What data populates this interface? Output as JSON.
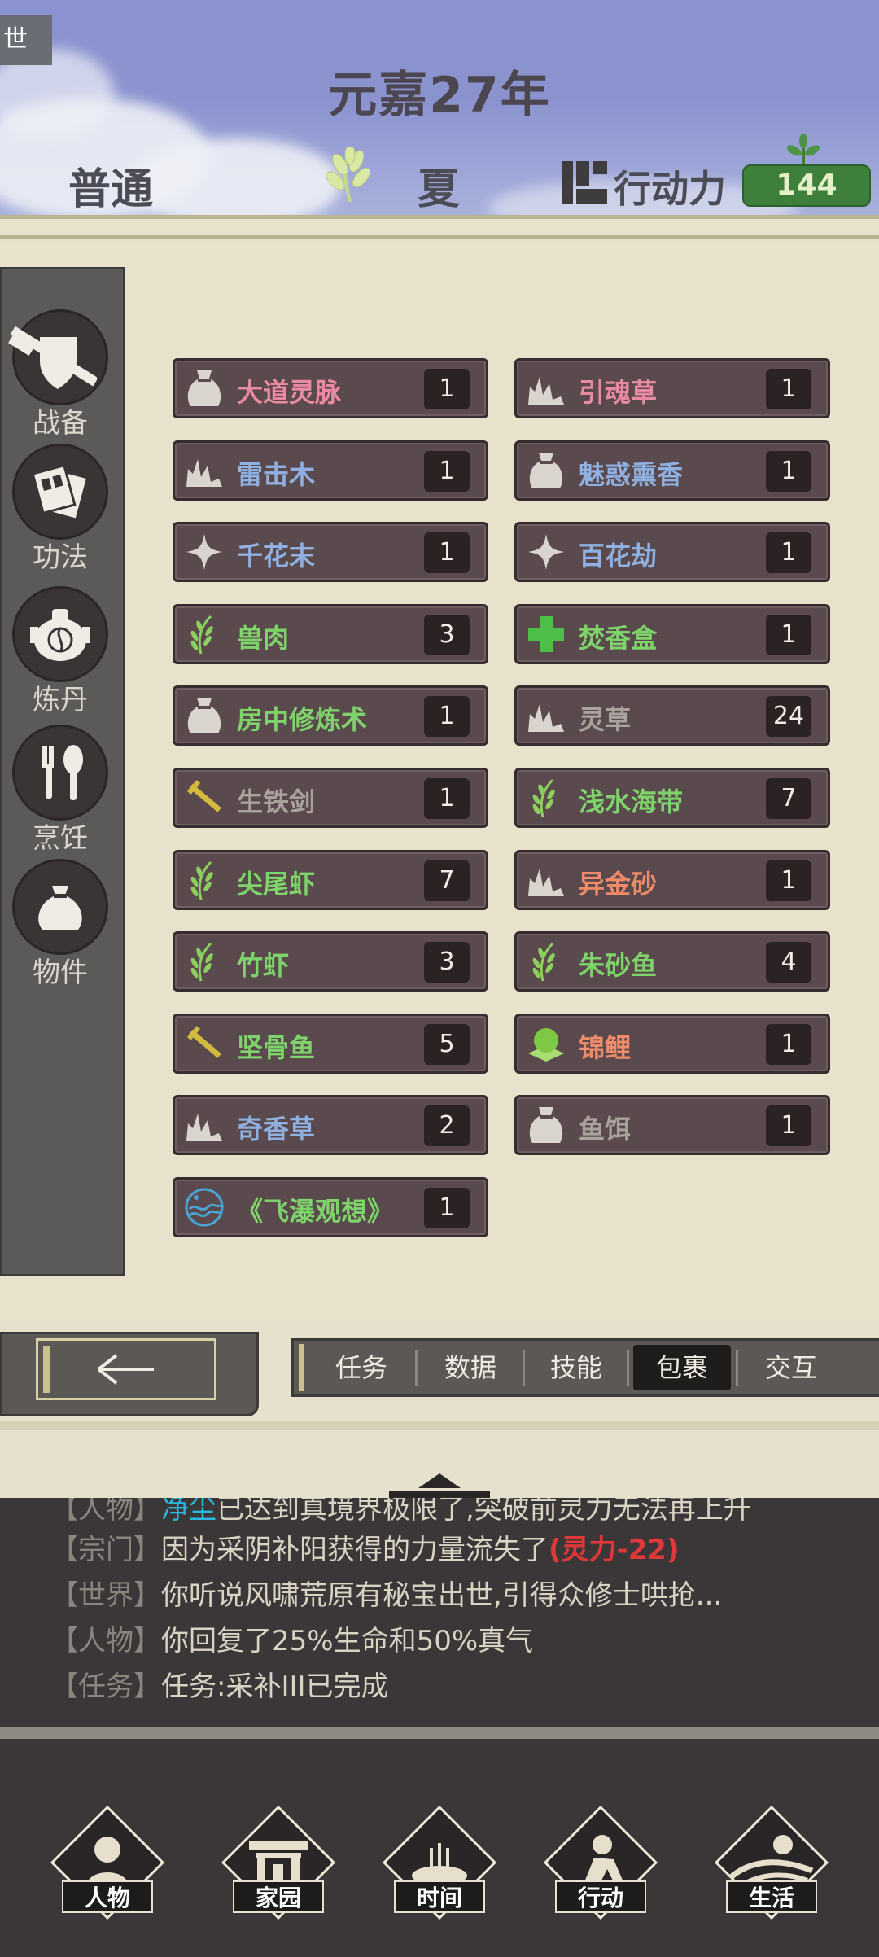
{
  "header": {
    "corner_button": "世",
    "era": "元嘉27年",
    "difficulty": "普通",
    "season": "夏",
    "action_points_label": "行动力",
    "action_points_value": "144"
  },
  "categories": [
    {
      "label": "战备"
    },
    {
      "label": "功法"
    },
    {
      "label": "炼丹"
    },
    {
      "label": "烹饪"
    },
    {
      "label": "物件"
    }
  ],
  "items": [
    {
      "name": "大道灵脉",
      "count": "1",
      "color": "#e98aa2",
      "icon": "pouch-icon"
    },
    {
      "name": "引魂草",
      "count": "1",
      "color": "#e98aa2",
      "icon": "herb-icon"
    },
    {
      "name": "雷击木",
      "count": "1",
      "color": "#8fb0e0",
      "icon": "herb-icon"
    },
    {
      "name": "魅惑熏香",
      "count": "1",
      "color": "#8fb0e0",
      "icon": "pouch-icon"
    },
    {
      "name": "千花末",
      "count": "1",
      "color": "#8fb0e0",
      "icon": "sparkle-icon"
    },
    {
      "name": "百花劫",
      "count": "1",
      "color": "#8fb0e0",
      "icon": "sparkle-icon"
    },
    {
      "name": "兽肉",
      "count": "3",
      "color": "#7fd36b",
      "icon": "grain-icon"
    },
    {
      "name": "焚香盒",
      "count": "1",
      "color": "#7fd36b",
      "icon": "cross-icon"
    },
    {
      "name": "房中修炼术",
      "count": "1",
      "color": "#7fd36b",
      "icon": "pouch-icon"
    },
    {
      "name": "灵草",
      "count": "24",
      "color": "#aaa29c",
      "icon": "herb-icon"
    },
    {
      "name": "生铁剑",
      "count": "1",
      "color": "#aaa29c",
      "icon": "sword-icon"
    },
    {
      "name": "浅水海带",
      "count": "7",
      "color": "#7fd36b",
      "icon": "grain-icon"
    },
    {
      "name": "尖尾虾",
      "count": "7",
      "color": "#7fd36b",
      "icon": "grain-icon"
    },
    {
      "name": "异金砂",
      "count": "1",
      "color": "#f08c6a",
      "icon": "herb-icon"
    },
    {
      "name": "竹虾",
      "count": "3",
      "color": "#7fd36b",
      "icon": "grain-icon"
    },
    {
      "name": "朱砂鱼",
      "count": "4",
      "color": "#7fd36b",
      "icon": "grain-icon"
    },
    {
      "name": "坚骨鱼",
      "count": "5",
      "color": "#7fd36b",
      "icon": "sword-icon"
    },
    {
      "name": "锦鲤",
      "count": "1",
      "color": "#f08c6a",
      "icon": "orb-icon"
    },
    {
      "name": "奇香草",
      "count": "2",
      "color": "#8fb0e0",
      "icon": "herb-icon"
    },
    {
      "name": "鱼饵",
      "count": "1",
      "color": "#aaa29c",
      "icon": "pouch-icon"
    },
    {
      "name": "《飞瀑观想》",
      "count": "1",
      "color": "#7fd36b",
      "icon": "wave-icon"
    }
  ],
  "tabs": [
    {
      "label": "任务",
      "active": false
    },
    {
      "label": "数据",
      "active": false
    },
    {
      "label": "技能",
      "active": false
    },
    {
      "label": "包裹",
      "active": true
    },
    {
      "label": "交互",
      "active": false
    }
  ],
  "back_label": "←",
  "log": [
    {
      "tag": "【人物】",
      "pre": "",
      "hl": "净尘",
      "text": "已达到真境界极限了,突破前灵力无法再上升",
      "red": ""
    },
    {
      "tag": "【宗门】",
      "pre": "",
      "hl": "",
      "text": "因为采阴补阳获得的力量流失了",
      "red": "(灵力-22)"
    },
    {
      "tag": "【世界】",
      "pre": "",
      "hl": "",
      "text": "你听说风啸荒原有秘宝出世,引得众修士哄抢...",
      "red": ""
    },
    {
      "tag": "【人物】",
      "pre": "",
      "hl": "",
      "text": "你回复了25%生命和50%真气",
      "red": ""
    },
    {
      "tag": "【任务】",
      "pre": "",
      "hl": "",
      "text": "任务:采补III已完成",
      "red": ""
    }
  ],
  "nav": [
    {
      "label": "人物",
      "icon": "person-icon"
    },
    {
      "label": "家园",
      "icon": "gate-icon"
    },
    {
      "label": "时间",
      "icon": "incense-icon"
    },
    {
      "label": "行动",
      "icon": "action-icon"
    },
    {
      "label": "生活",
      "icon": "landscape-icon"
    }
  ]
}
